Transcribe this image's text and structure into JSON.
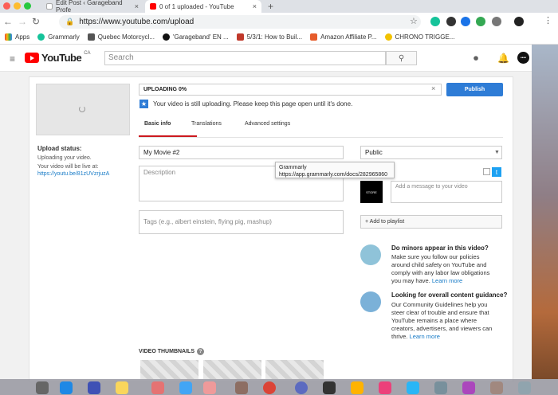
{
  "browser": {
    "tabs": [
      {
        "label": "Edit Post ‹ Garageband Profe",
        "close": "×"
      },
      {
        "label": "0 of 1 uploaded - YouTube",
        "close": "×"
      }
    ],
    "new_tab": "+",
    "url": "https://www.youtube.com/upload",
    "bookmarks": [
      {
        "label": "Apps"
      },
      {
        "label": "Grammarly"
      },
      {
        "label": "Quebec Motorcycl..."
      },
      {
        "label": "'Garageband' EN ..."
      },
      {
        "label": "5/3/1: How to Buil..."
      },
      {
        "label": "Amazon Affiliate P..."
      },
      {
        "label": "CHRONO TRIGGE..."
      }
    ]
  },
  "youtube": {
    "logo_text": "YouTube",
    "region": "CA",
    "search_placeholder": "Search",
    "avatar_text": "••••"
  },
  "upload": {
    "progress": "UPLOADING 0%",
    "progress_fraction": 0,
    "publish": "Publish",
    "notice": "Your video is still uploading. Please keep this page open until it's done.",
    "status_label": "Upload status:",
    "status_line1": "Uploading your video.",
    "status_line2": "Your video will be live at:",
    "video_url": "https://youtu.be/81zUVzrjuzA"
  },
  "tabs": [
    "Basic info",
    "Translations",
    "Advanced settings"
  ],
  "form": {
    "title_value": "My Movie #2",
    "description_placeholder": "Description",
    "tags_placeholder": "Tags (e.g., albert einstein, flying pig, mashup)",
    "privacy": "Public",
    "message_placeholder": "Add a message to your video",
    "add_playlist": "+ Add to playlist",
    "channel_thumb_text": "STORE"
  },
  "tooltip": {
    "title": "Grammarly",
    "url": "https://app.grammarly.com/docs/282965860"
  },
  "guidance": [
    {
      "title": "Do minors appear in this video?",
      "lines": [
        "Make sure you follow our policies",
        "around child safety on YouTube and",
        "comply with any labor law obligations",
        "you may have."
      ],
      "link": "Learn more"
    },
    {
      "title": "Looking for overall content guidance?",
      "lines": [
        "Our Community Guidelines help you",
        "steer clear of trouble and ensure that",
        "YouTube remains a place where",
        "creators, advertisers, and viewers can",
        "thrive."
      ],
      "link": "Learn more"
    }
  ],
  "thumbnails_label": "VIDEO THUMBNAILS",
  "thumbnails_help": "?"
}
